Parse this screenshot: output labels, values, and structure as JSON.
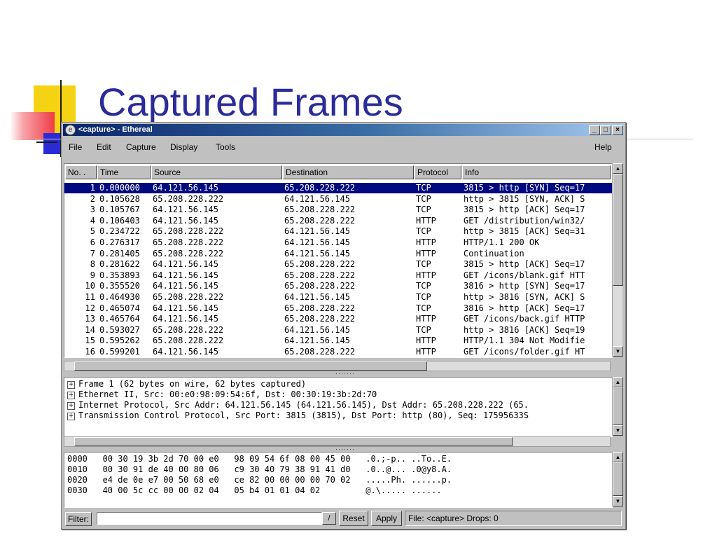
{
  "slide": {
    "title": "Captured Frames"
  },
  "window": {
    "title": "<capture> - Ethereal",
    "minimize": "_",
    "maximize": "□",
    "close": "×"
  },
  "menu": [
    "File",
    "Edit",
    "Capture",
    "Display",
    "Tools"
  ],
  "menu_help": "Help",
  "packet_list": {
    "columns": [
      "No. .",
      "Time",
      "Source",
      "Destination",
      "Protocol",
      "Info"
    ],
    "rows": [
      [
        "1",
        "0.000000",
        "64.121.56.145",
        "65.208.228.222",
        "TCP",
        "3815 > http [SYN] Seq=17"
      ],
      [
        "2",
        "0.105628",
        "65.208.228.222",
        "64.121.56.145",
        "TCP",
        "http > 3815 [SYN, ACK] S"
      ],
      [
        "3",
        "0.105767",
        "64.121.56.145",
        "65.208.228.222",
        "TCP",
        "3815 > http [ACK] Seq=17"
      ],
      [
        "4",
        "0.106403",
        "64.121.56.145",
        "65.208.228.222",
        "HTTP",
        "GET /distribution/win32/"
      ],
      [
        "5",
        "0.234722",
        "65.208.228.222",
        "64.121.56.145",
        "TCP",
        "http > 3815 [ACK] Seq=31"
      ],
      [
        "6",
        "0.276317",
        "65.208.228.222",
        "64.121.56.145",
        "HTTP",
        "HTTP/1.1 200 OK"
      ],
      [
        "7",
        "0.281405",
        "65.208.228.222",
        "64.121.56.145",
        "HTTP",
        "Continuation"
      ],
      [
        "8",
        "0.281622",
        "64.121.56.145",
        "65.208.228.222",
        "TCP",
        "3815 > http [ACK] Seq=17"
      ],
      [
        "9",
        "0.353893",
        "64.121.56.145",
        "65.208.228.222",
        "HTTP",
        "GET /icons/blank.gif HTT"
      ],
      [
        "10",
        "0.355520",
        "64.121.56.145",
        "65.208.228.222",
        "TCP",
        "3816 > http [SYN] Seq=17"
      ],
      [
        "11",
        "0.464930",
        "65.208.228.222",
        "64.121.56.145",
        "TCP",
        "http > 3816 [SYN, ACK] S"
      ],
      [
        "12",
        "0.465074",
        "64.121.56.145",
        "65.208.228.222",
        "TCP",
        "3816 > http [ACK] Seq=17"
      ],
      [
        "13",
        "0.465764",
        "64.121.56.145",
        "65.208.228.222",
        "HTTP",
        "GET /icons/back.gif HTTP"
      ],
      [
        "14",
        "0.593027",
        "65.208.228.222",
        "64.121.56.145",
        "TCP",
        "http > 3816 [ACK] Seq=19"
      ],
      [
        "15",
        "0.595262",
        "65.208.228.222",
        "64.121.56.145",
        "HTTP",
        "HTTP/1.1 304 Not Modifie"
      ],
      [
        "16",
        "0.599201",
        "64.121.56.145",
        "65.208.228.222",
        "HTTP",
        "GET /icons/folder.gif HT"
      ]
    ]
  },
  "detail_tree": [
    "Frame 1 (62 bytes on wire, 62 bytes captured)",
    "Ethernet II, Src: 00:e0:98:09:54:6f, Dst: 00:30:19:3b:2d:70",
    "Internet Protocol, Src Addr: 64.121.56.145 (64.121.56.145), Dst Addr: 65.208.228.222 (65.",
    "Transmission Control Protocol, Src Port: 3815 (3815), Dst Port: http (80), Seq: 17595633S"
  ],
  "hex_dump": [
    "0000   00 30 19 3b 2d 70 00 e0   98 09 54 6f 08 00 45 00   .0.;-p.. ..To..E.",
    "0010   00 30 91 de 40 00 80 06   c9 30 40 79 38 91 41 d0   .0..@... .0@y8.A.",
    "0020   e4 de 0e e7 00 50 68 e0   ce 82 00 00 00 00 70 02   .....Ph. ......p.",
    "0030   40 00 5c cc 00 00 02 04   05 b4 01 01 04 02         @.\\..... ......"
  ],
  "statusbar": {
    "filter_label": "Filter:",
    "filter_value": "",
    "dropdown": "/",
    "reset": "Reset",
    "apply": "Apply",
    "status": "File: <capture>  Drops: 0"
  }
}
